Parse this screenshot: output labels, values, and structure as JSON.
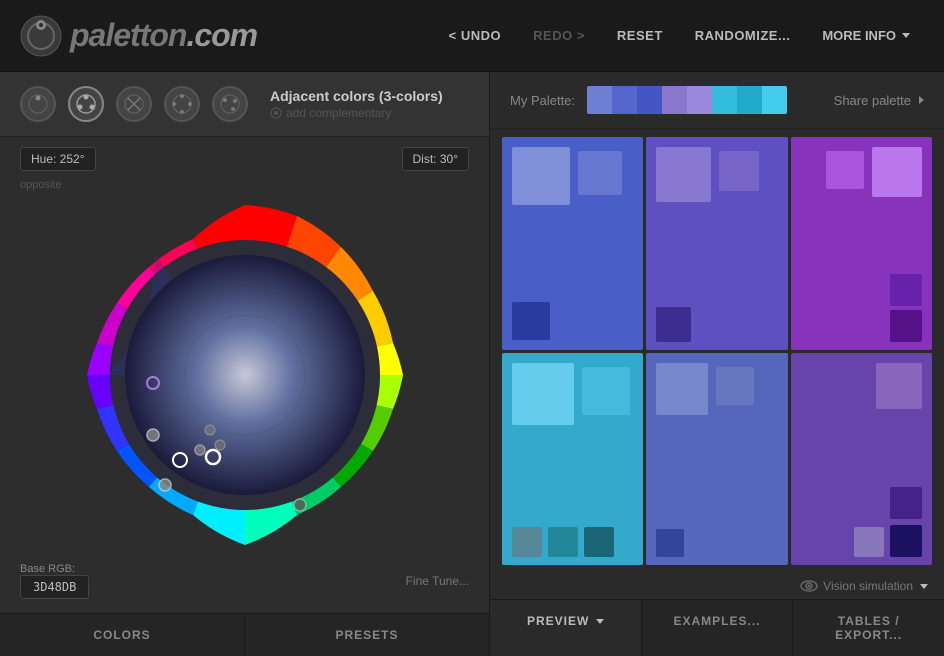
{
  "header": {
    "logo_text": "paletton",
    "logo_domain": ".com",
    "nav": {
      "undo": "< UNDO",
      "redo": "REDO >",
      "reset": "RESET",
      "randomize": "RANDOMIZE...",
      "more_info": "MORE INFO"
    }
  },
  "scheme": {
    "title": "Adjacent colors (3-colors)",
    "sub_label": "add complementary"
  },
  "wheel": {
    "hue_label": "Hue: 252°",
    "dist_label": "Dist: 30°",
    "opposite_label": "opposite",
    "base_rgb_label": "Base RGB:",
    "base_rgb_value": "3D48DB",
    "fine_tune": "Fine Tune..."
  },
  "palette_bar": {
    "label": "My Palette:",
    "share_label": "Share palette",
    "segments": [
      "#6e7fd4",
      "#5566cc",
      "#4455c4",
      "#8877cc",
      "#9988dd",
      "#33bbdd",
      "#22aacc",
      "#44ccee"
    ]
  },
  "color_grid": {
    "cells": [
      {
        "bg": "#4d5ec9",
        "swatches": [
          {
            "c": "#7a8dd9",
            "size": 60
          },
          {
            "c": "#6070d0",
            "size": 45
          }
        ]
      },
      {
        "bg": "#6655bb",
        "swatches": [
          {
            "c": "#8877cc",
            "size": 55
          },
          {
            "c": "#7766c0",
            "size": 40
          }
        ]
      },
      {
        "bg": "#8833bb",
        "swatches": [
          {
            "c": "#aa66dd",
            "size": 50
          },
          {
            "c": "#9944cc",
            "size": 38
          }
        ]
      },
      {
        "bg": "#33aacc",
        "swatches": [
          {
            "c": "#66ccdd",
            "size": 65
          },
          {
            "c": "#44bbcc",
            "size": 48
          }
        ]
      },
      {
        "bg": "#5566bb",
        "swatches": [
          {
            "c": "#7788cc",
            "size": 55
          },
          {
            "c": "#6677c0",
            "size": 40
          }
        ]
      },
      {
        "bg": "#6644aa",
        "swatches": [
          {
            "c": "#8866bb",
            "size": 50
          },
          {
            "c": "#7755aa",
            "size": 36
          }
        ]
      }
    ]
  },
  "vision": {
    "label": "Vision simulation"
  },
  "left_tabs": {
    "colors": "COLORS",
    "presets": "PRESETS"
  },
  "right_tabs": {
    "preview": "PREVIEW",
    "examples": "EXAMPLES...",
    "tables": "TABLES / EXPORT..."
  }
}
